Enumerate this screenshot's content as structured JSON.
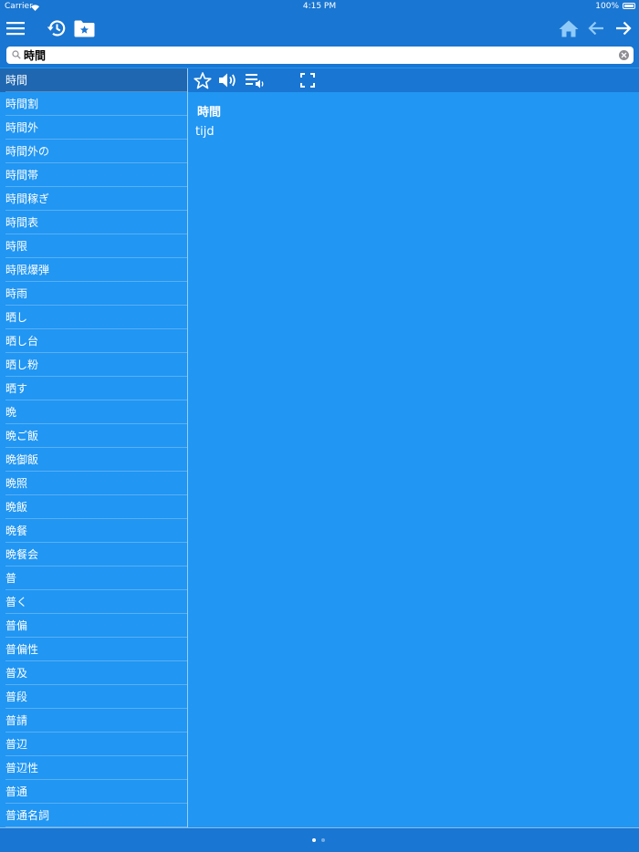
{
  "status": {
    "carrier": "Carrier",
    "time": "4:15 PM",
    "battery": "100%"
  },
  "search": {
    "value": "時間",
    "placeholder": ""
  },
  "words": [
    "時間",
    "時間割",
    "時間外",
    "時間外の",
    "時間帯",
    "時間稼ぎ",
    "時間表",
    "時限",
    "時限爆弾",
    "時雨",
    "晒し",
    "晒し台",
    "晒し粉",
    "晒す",
    "晩",
    "晩ご飯",
    "晩御飯",
    "晩照",
    "晩飯",
    "晩餐",
    "晩餐会",
    "普",
    "普く",
    "普偏",
    "普偏性",
    "普及",
    "普段",
    "普請",
    "普辺",
    "普辺性",
    "普通",
    "普通名詞"
  ],
  "selected_index": 0,
  "entry": {
    "headword": "時間",
    "translation": "tijd"
  },
  "page_indicator": {
    "pages": 2,
    "current": 0
  },
  "colors": {
    "background": "#2196F3",
    "bar": "#1976D2",
    "selected": "#1F67B1"
  }
}
